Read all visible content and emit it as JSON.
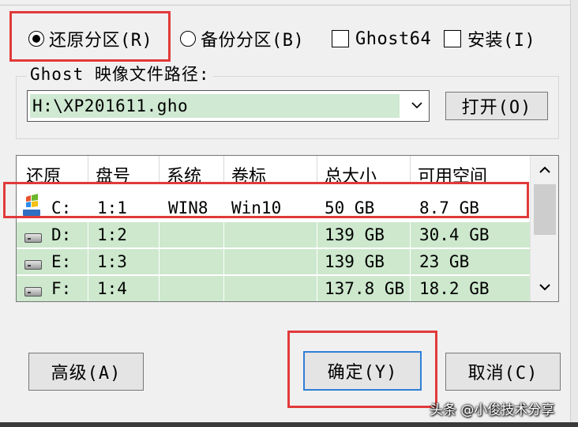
{
  "options": {
    "restore": {
      "label": "还原分区(R)",
      "selected": true
    },
    "backup": {
      "label": "备份分区(B)",
      "selected": false
    },
    "ghost64": {
      "label": "Ghost64",
      "checked": false
    },
    "install": {
      "label": "安装(I)",
      "checked": false
    }
  },
  "image_path": {
    "label": "Ghost 映像文件路径:",
    "value": "H:\\XP201611.gho",
    "open_button": "打开(O)"
  },
  "partition_list": {
    "headers": [
      "还原",
      "盘号",
      "系统",
      "卷标",
      "总大小",
      "可用空间"
    ],
    "rows": [
      {
        "icon": "windows-drive-icon",
        "drive": "C:",
        "disk": "1:1",
        "system": "WIN8",
        "label": "Win10",
        "total": "50 GB",
        "free": "8.7 GB"
      },
      {
        "icon": "hard-drive-icon",
        "drive": "D:",
        "disk": "1:2",
        "system": "",
        "label": "",
        "total": "139 GB",
        "free": "30.4 GB"
      },
      {
        "icon": "hard-drive-icon",
        "drive": "E:",
        "disk": "1:3",
        "system": "",
        "label": "",
        "total": "139 GB",
        "free": "23 GB"
      },
      {
        "icon": "hard-drive-icon",
        "drive": "F:",
        "disk": "1:4",
        "system": "",
        "label": "",
        "total": "137.8 GB",
        "free": "18.2 GB"
      }
    ]
  },
  "buttons": {
    "advanced": "高级(A)",
    "ok": "确定(Y)",
    "cancel": "取消(C)"
  },
  "watermark": "头条 @小俊技术分享",
  "colors": {
    "highlight_red": "#e23a3a",
    "row_green": "#cde8cd",
    "ok_border": "#2f7fd6"
  }
}
